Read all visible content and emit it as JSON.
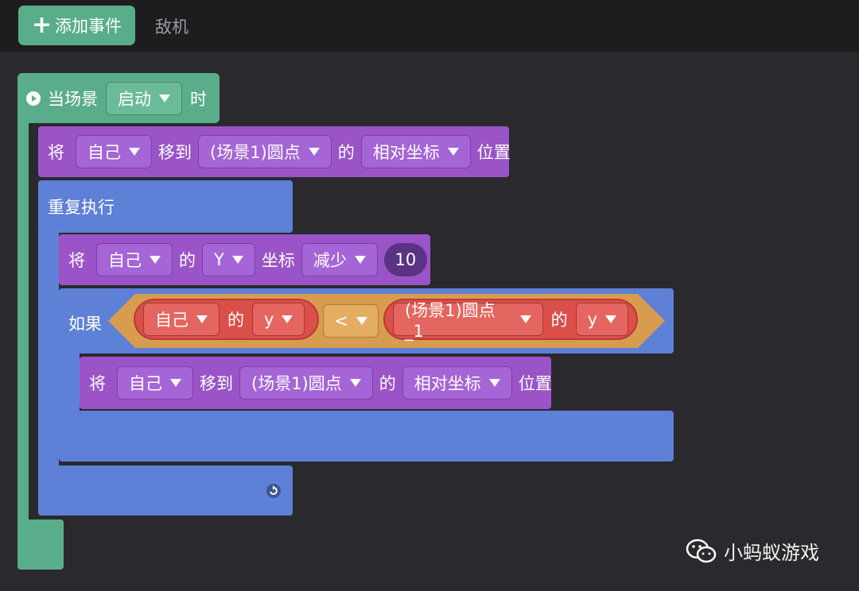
{
  "toolbar": {
    "add_event_label": "添加事件",
    "tab_enemy": "敌机"
  },
  "event": {
    "prefix": "当场景",
    "trigger": "启动",
    "suffix": "时"
  },
  "move1": {
    "verb": "将",
    "subject": "自己",
    "moveto": "移到",
    "target": "(场景1)圆点",
    "of": "的",
    "mode": "相对坐标",
    "pos": "位置"
  },
  "repeat": {
    "label": "重复执行"
  },
  "change_y": {
    "verb": "将",
    "subject": "自己",
    "of": "的",
    "axis": "Y",
    "coord": "坐标",
    "op": "减少",
    "amount": "10"
  },
  "ifblock": {
    "label": "如果",
    "left_obj": "自己",
    "left_of": "的",
    "left_prop": "y",
    "comparator": "<",
    "right_obj": "(场景1)圆点_1",
    "right_of": "的",
    "right_prop": "y"
  },
  "move2": {
    "verb": "将",
    "subject": "自己",
    "moveto": "移到",
    "target": "(场景1)圆点",
    "of": "的",
    "mode": "相对坐标",
    "pos": "位置"
  },
  "watermark": {
    "text": "小蚂蚁游戏"
  },
  "colors": {
    "event": "#5aad8a",
    "action": "#9a54c8",
    "control": "#5e80d6",
    "compare": "#d89c4e",
    "property": "#db4f4a"
  }
}
